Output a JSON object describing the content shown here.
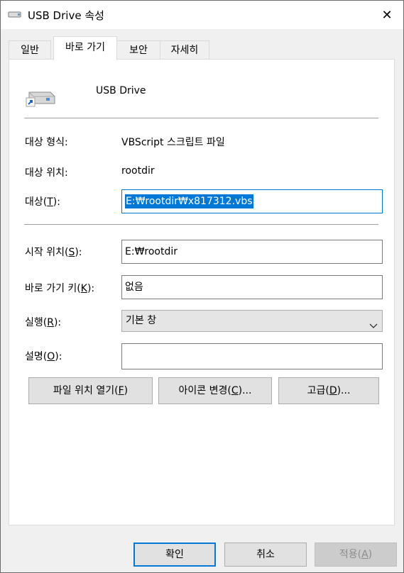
{
  "window": {
    "title": "USB Drive 속성",
    "close_glyph": "✕",
    "icon": "usb-drive-icon"
  },
  "tabs": [
    {
      "label": "일반",
      "active": false
    },
    {
      "label": "바로 가기",
      "active": true
    },
    {
      "label": "보안",
      "active": false
    },
    {
      "label": "자세히",
      "active": false
    }
  ],
  "shortcut": {
    "name": "USB Drive",
    "icon": "shortcut-drive-icon",
    "target_type_label": "대상 형식:",
    "target_type_value": "VBScript 스크립트 파일",
    "target_location_label": "대상 위치:",
    "target_location_value": "rootdir",
    "target_label": "대상(",
    "target_key": "T",
    "target_label_end": "):",
    "target_value": "E:₩rootdir₩x817312.vbs",
    "start_in_label": "시작 위치(",
    "start_in_key": "S",
    "start_in_label_end": "):",
    "start_in_value": "E:₩rootdir",
    "hotkey_label": "바로 가기 키(",
    "hotkey_key": "K",
    "hotkey_label_end": "):",
    "hotkey_value": "없음",
    "run_label": "실행(",
    "run_key": "R",
    "run_label_end": "):",
    "run_value": "기본 창",
    "comment_label": "설명(",
    "comment_key": "O",
    "comment_label_end": "):",
    "comment_value": ""
  },
  "buttons": {
    "open_location_pre": "파일 위치 열기(",
    "open_location_key": "F",
    "open_location_post": ")",
    "change_icon_pre": "아이콘 변경(",
    "change_icon_key": "C",
    "change_icon_post": ")...",
    "advanced_pre": "고급(",
    "advanced_key": "D",
    "advanced_post": ")...",
    "ok": "확인",
    "cancel": "취소",
    "apply_pre": "적용(",
    "apply_key": "A",
    "apply_post": ")"
  }
}
